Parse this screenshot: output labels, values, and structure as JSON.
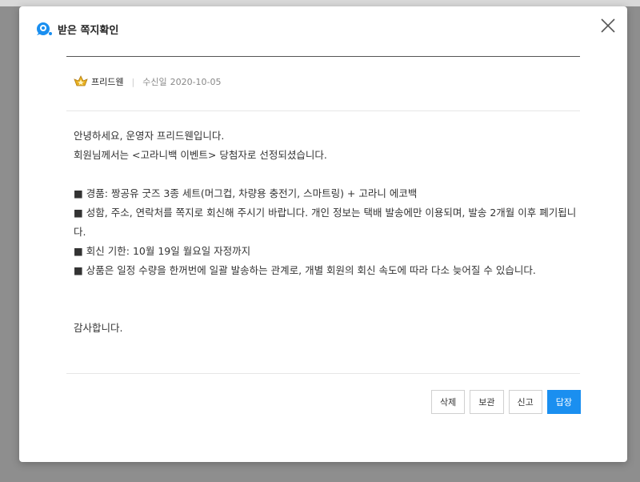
{
  "dialog": {
    "title": "받은 쪽지확인",
    "close_icon": "close-icon"
  },
  "message": {
    "sender": "프리드웬",
    "received_label": "수신일",
    "received_date": "2020-10-05",
    "lines": [
      "안녕하세요, 운영자 프리드웬입니다.",
      "회원님께서는 <고라니백 이벤트> 당첨자로 선정되셨습니다.",
      "■ 경품: 짱공유 굿즈 3종 세트(머그컵, 차량용 충전기, 스마트링) + 고라니 에코백",
      "■ 성함, 주소, 연락처를 쪽지로 회신해 주시기 바랍니다. 개인 정보는 택배 발송에만 이용되며, 발송 2개월 이후 폐기됩니다.",
      "■ 회신 기한: 10월 19일 월요일 자정까지",
      "■ 상품은 일정 수량을 한꺼번에 일괄 발송하는 관계로, 개별 회원의 회신 속도에 따라 다소 늦어질 수 있습니다.",
      "감사합니다."
    ]
  },
  "actions": {
    "delete": "삭제",
    "keep": "보관",
    "report": "신고",
    "reply": "답장"
  },
  "colors": {
    "primary": "#1a8ff0",
    "overlay": "#8e8e8e"
  }
}
